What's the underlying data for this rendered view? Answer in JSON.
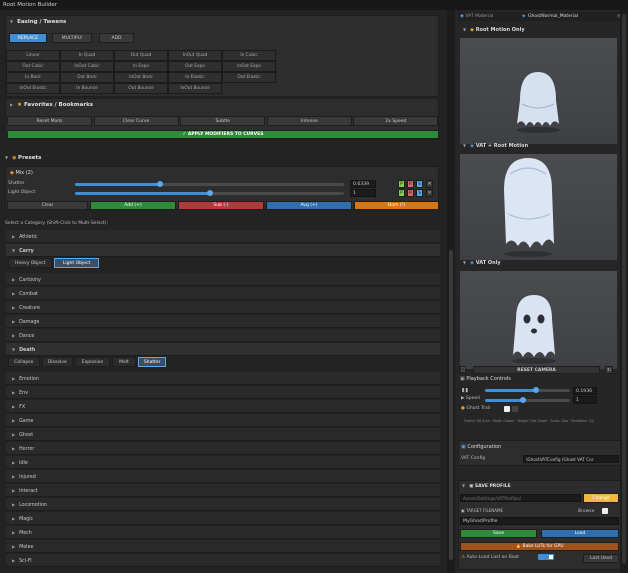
{
  "window": {
    "title": "Root Motion Builder"
  },
  "easing": {
    "header": "Easing / Tweens",
    "modes": [
      "REPLACE",
      "MULTIPLY",
      "ADD"
    ],
    "grid": [
      [
        "Linear",
        "In Quad",
        "Out Quad",
        "InOut Quad",
        "In Cubic"
      ],
      [
        "Out Cubic",
        "InOut Cubic",
        "In Expo",
        "Out Expo",
        "InOut Expo"
      ],
      [
        "In Back",
        "Out Back",
        "InOut Back",
        "In Elastic",
        "Out Elastic"
      ],
      [
        "InOut Elastic",
        "In Bounce",
        "Out Bounce",
        "InOut Bounce",
        ""
      ]
    ]
  },
  "favorites": {
    "header": "Favorites / Bookmarks",
    "items": [
      "Reset Mods",
      "Clear Curve",
      "Subtle",
      "Intense",
      "2x Speed"
    ],
    "apply": "✓ APPLY MODIFIERS TO CURVES"
  },
  "presets": {
    "header": "Presets",
    "mix_label": "Mix (2)",
    "rows": [
      {
        "label": "Shatter",
        "value": "0.6339",
        "fill": 0.6339
      },
      {
        "label": "Light Object",
        "value": "1",
        "fill": 0.5
      }
    ],
    "actions": [
      "Clear",
      "Add (+)",
      "Sub (-)",
      "Avg (+)",
      "Dom (!)"
    ],
    "category_hint": "Select a Category (Shift-Click to Multi-Select):"
  },
  "categories": {
    "before": [
      "Athletic"
    ],
    "carry": {
      "name": "Carry",
      "tabs": [
        "Heavy Object",
        "Light Object"
      ],
      "active": "Light Object"
    },
    "middle": [
      "Cartoony",
      "Combat",
      "Creature",
      "Damage",
      "Dance"
    ],
    "death": {
      "name": "Death",
      "tabs": [
        "Collapse",
        "Dissolve",
        "Explosion",
        "Melt",
        "Shatter"
      ],
      "active": "Shatter"
    },
    "after": [
      "Emotion",
      "Env",
      "FX",
      "Game",
      "Ghost",
      "Horror",
      "Idle",
      "Injured",
      "Interact",
      "Locomotion",
      "Magic",
      "Mech",
      "Melee",
      "Sci-Fi"
    ]
  },
  "right": {
    "vat_material_label": "VAT Material",
    "vat_material_value": "GhostNormal_Material",
    "previews": [
      "Root Motion Only",
      "VAT + Root Motion",
      "VAT Only"
    ],
    "reset_camera": "RESET CAMERA",
    "playback": {
      "header": "Playback Controls",
      "time_value": "0.1936",
      "speed_label": "Speed",
      "speed_value": "1",
      "ghost_trail": "Ghost Trail",
      "time_fill": 0.6,
      "speed_fill": 0.45
    },
    "footer_hint": "Frame: 00 Sum · Multi: Colors · Target: Get Ghost · Scale: Zoo · Realtime: 1/2",
    "config": {
      "header": "Configuration",
      "label": "VAT Config",
      "value": "\\GhostVATConfig (Ghost VAT Cor"
    },
    "save_profile": {
      "header": "SAVE PROFILE",
      "path": "Assets/Settings/VATProfiles/",
      "change": "Change",
      "target_label": "TARGET FILENAME",
      "browse": "Browse",
      "filename": "MyGhostProfile",
      "save": "Save",
      "load": "Load",
      "bake": "🔥 Bake LUTs for GPU",
      "autoload": "Auto-Load Last on Boot",
      "last_used": "Last Used"
    }
  },
  "colors": {
    "accent": "#3d8fd8",
    "green": "#2e8b3a",
    "red": "#b33a3a",
    "blue": "#2f6fb0",
    "orange": "#d8760f"
  }
}
